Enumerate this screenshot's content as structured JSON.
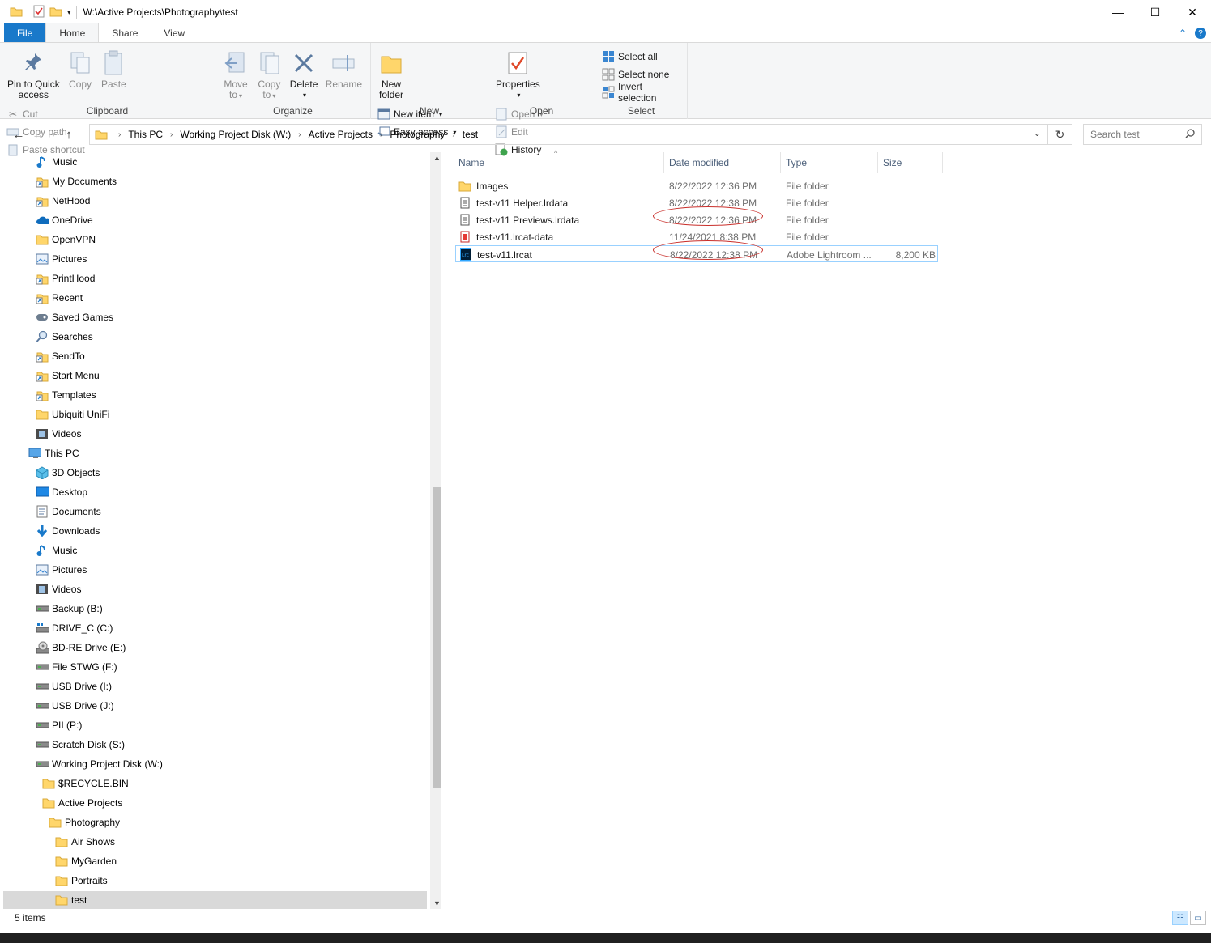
{
  "window": {
    "title": "W:\\Active Projects\\Photography\\test",
    "minimize": "—",
    "maximize": "☐",
    "close": "✕"
  },
  "ribbon_tabs": [
    "File",
    "Home",
    "Share",
    "View"
  ],
  "ribbon": {
    "clipboard": {
      "label": "Clipboard",
      "pin_line1": "Pin to Quick",
      "pin_line2": "access",
      "copy": "Copy",
      "paste": "Paste",
      "cut": "Cut",
      "copy_path": "Copy path",
      "paste_shortcut": "Paste shortcut"
    },
    "organize": {
      "label": "Organize",
      "move_line1": "Move",
      "move_line2": "to",
      "copy_line1": "Copy",
      "copy_line2": "to",
      "delete": "Delete",
      "rename": "Rename"
    },
    "new": {
      "label": "New",
      "new_folder_line1": "New",
      "new_folder_line2": "folder",
      "new_item": "New item",
      "easy_access": "Easy access"
    },
    "open": {
      "label": "Open",
      "properties": "Properties",
      "open": "Open",
      "edit": "Edit",
      "history": "History"
    },
    "select": {
      "label": "Select",
      "select_all": "Select all",
      "select_none": "Select none",
      "invert_selection": "Invert selection"
    }
  },
  "address": {
    "crumbs": [
      "This PC",
      "Working Project Disk (W:)",
      "Active Projects",
      "Photography",
      "test"
    ],
    "search_placeholder": "Search test"
  },
  "nav_items": [
    {
      "label": "Music",
      "icon": "music-icon"
    },
    {
      "label": "My Documents",
      "icon": "shortcut-icon"
    },
    {
      "label": "NetHood",
      "icon": "shortcut-icon"
    },
    {
      "label": "OneDrive",
      "icon": "cloud-icon"
    },
    {
      "label": "OpenVPN",
      "icon": "folder-icon"
    },
    {
      "label": "Pictures",
      "icon": "pictures-icon"
    },
    {
      "label": "PrintHood",
      "icon": "shortcut-icon"
    },
    {
      "label": "Recent",
      "icon": "shortcut-icon"
    },
    {
      "label": "Saved Games",
      "icon": "games-icon"
    },
    {
      "label": "Searches",
      "icon": "search-icon"
    },
    {
      "label": "SendTo",
      "icon": "shortcut-icon"
    },
    {
      "label": "Start Menu",
      "icon": "shortcut-icon"
    },
    {
      "label": "Templates",
      "icon": "shortcut-icon"
    },
    {
      "label": "Ubiquiti UniFi",
      "icon": "folder-icon"
    },
    {
      "label": "Videos",
      "icon": "videos-icon"
    },
    {
      "label": "This PC",
      "icon": "pc-icon"
    },
    {
      "label": "3D Objects",
      "icon": "cube-icon"
    },
    {
      "label": "Desktop",
      "icon": "desktop-icon"
    },
    {
      "label": "Documents",
      "icon": "documents-icon"
    },
    {
      "label": "Downloads",
      "icon": "download-icon"
    },
    {
      "label": "Music",
      "icon": "music-icon"
    },
    {
      "label": "Pictures",
      "icon": "pictures-icon"
    },
    {
      "label": "Videos",
      "icon": "videos-icon"
    },
    {
      "label": "Backup (B:)",
      "icon": "drive-icon"
    },
    {
      "label": "DRIVE_C (C:)",
      "icon": "windows-drive-icon"
    },
    {
      "label": "BD-RE Drive (E:)",
      "icon": "disc-drive-icon"
    },
    {
      "label": "File STWG (F:)",
      "icon": "drive-icon"
    },
    {
      "label": "USB Drive (I:)",
      "icon": "drive-icon"
    },
    {
      "label": "USB Drive (J:)",
      "icon": "drive-icon"
    },
    {
      "label": "PII (P:)",
      "icon": "drive-icon"
    },
    {
      "label": "Scratch Disk (S:)",
      "icon": "drive-icon"
    },
    {
      "label": "Working Project Disk (W:)",
      "icon": "drive-icon"
    },
    {
      "label": "$RECYCLE.BIN",
      "icon": "folder-icon"
    },
    {
      "label": "Active Projects",
      "icon": "folder-icon"
    },
    {
      "label": "Photography",
      "icon": "folder-icon"
    },
    {
      "label": "Air Shows",
      "icon": "folder-icon"
    },
    {
      "label": "MyGarden",
      "icon": "folder-icon"
    },
    {
      "label": "Portraits",
      "icon": "folder-icon"
    },
    {
      "label": "test",
      "icon": "folder-icon",
      "selected": true
    }
  ],
  "columns": {
    "name": "Name",
    "date": "Date modified",
    "type": "Type",
    "size": "Size"
  },
  "files": [
    {
      "name": "Images",
      "date": "8/22/2022 12:36 PM",
      "type": "File folder",
      "size": "",
      "icon": "folder-icon"
    },
    {
      "name": "test-v11 Helper.lrdata",
      "date": "8/22/2022 12:38 PM",
      "type": "File folder",
      "size": "",
      "icon": "lrdata-file-icon"
    },
    {
      "name": "test-v11 Previews.lrdata",
      "date": "8/22/2022 12:36 PM",
      "type": "File folder",
      "size": "",
      "icon": "lrdata-file-icon",
      "circled": true
    },
    {
      "name": "test-v11.lrcat-data",
      "date": "11/24/2021 8:38 PM",
      "type": "File folder",
      "size": "",
      "icon": "lrcat-data-icon"
    },
    {
      "name": "test-v11.lrcat",
      "date": "8/22/2022 12:38 PM",
      "type": "Adobe Lightroom ...",
      "size": "8,200 KB",
      "icon": "lightroom-catalog-icon",
      "circled": true,
      "selected": true
    }
  ],
  "status": {
    "item_count": "5 items"
  },
  "colors": {
    "accent": "#1979ca",
    "folder": "#ffd66b",
    "annotation": "#c9302c",
    "selection": "#cce8ff"
  }
}
